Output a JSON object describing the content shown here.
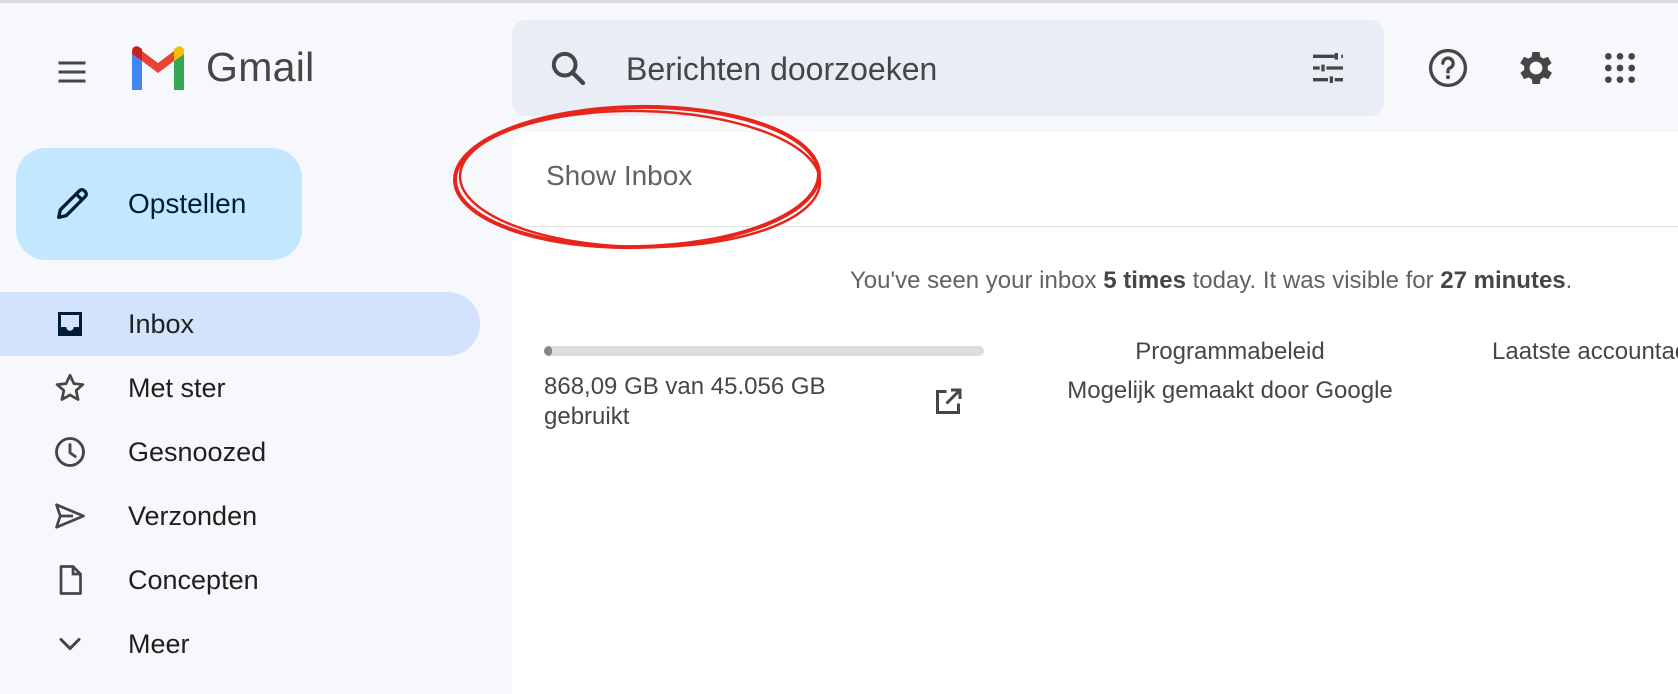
{
  "app": {
    "name": "Gmail"
  },
  "search": {
    "placeholder": "Berichten doorzoeken"
  },
  "header": {
    "menu_icon": "hamburger-menu-icon",
    "help_icon": "help-icon",
    "settings_icon": "gear-icon",
    "apps_icon": "apps-grid-icon"
  },
  "compose": {
    "label": "Opstellen",
    "icon": "pencil-icon"
  },
  "sidebar": {
    "items": [
      {
        "label": "Inbox",
        "icon": "inbox-icon",
        "active": true
      },
      {
        "label": "Met ster",
        "icon": "star-icon"
      },
      {
        "label": "Gesnoozed",
        "icon": "clock-icon"
      },
      {
        "label": "Verzonden",
        "icon": "send-icon"
      },
      {
        "label": "Concepten",
        "icon": "draft-icon"
      },
      {
        "label": "Meer",
        "icon": "chevron-down-icon"
      }
    ]
  },
  "main": {
    "show_inbox": "Show Inbox",
    "stats": {
      "prefix": "You've seen your inbox ",
      "count": "5 times",
      "middle": " today. It was visible for ",
      "duration": "27 minutes",
      "suffix": "."
    },
    "storage": {
      "text": "868,09 GB van 45.056 GB gebruikt",
      "used_fraction": 0.019
    },
    "footer": {
      "policy": "Programmabeleid",
      "powered": "Mogelijk gemaakt door Google",
      "last_activity": "Laatste accountactiviteit"
    }
  },
  "colors": {
    "background": "#f6f8fc",
    "compose": "#c2e7ff",
    "active_nav": "#d3e3fd",
    "search_bg": "#e9eef6",
    "annotation": "#e8251a"
  }
}
